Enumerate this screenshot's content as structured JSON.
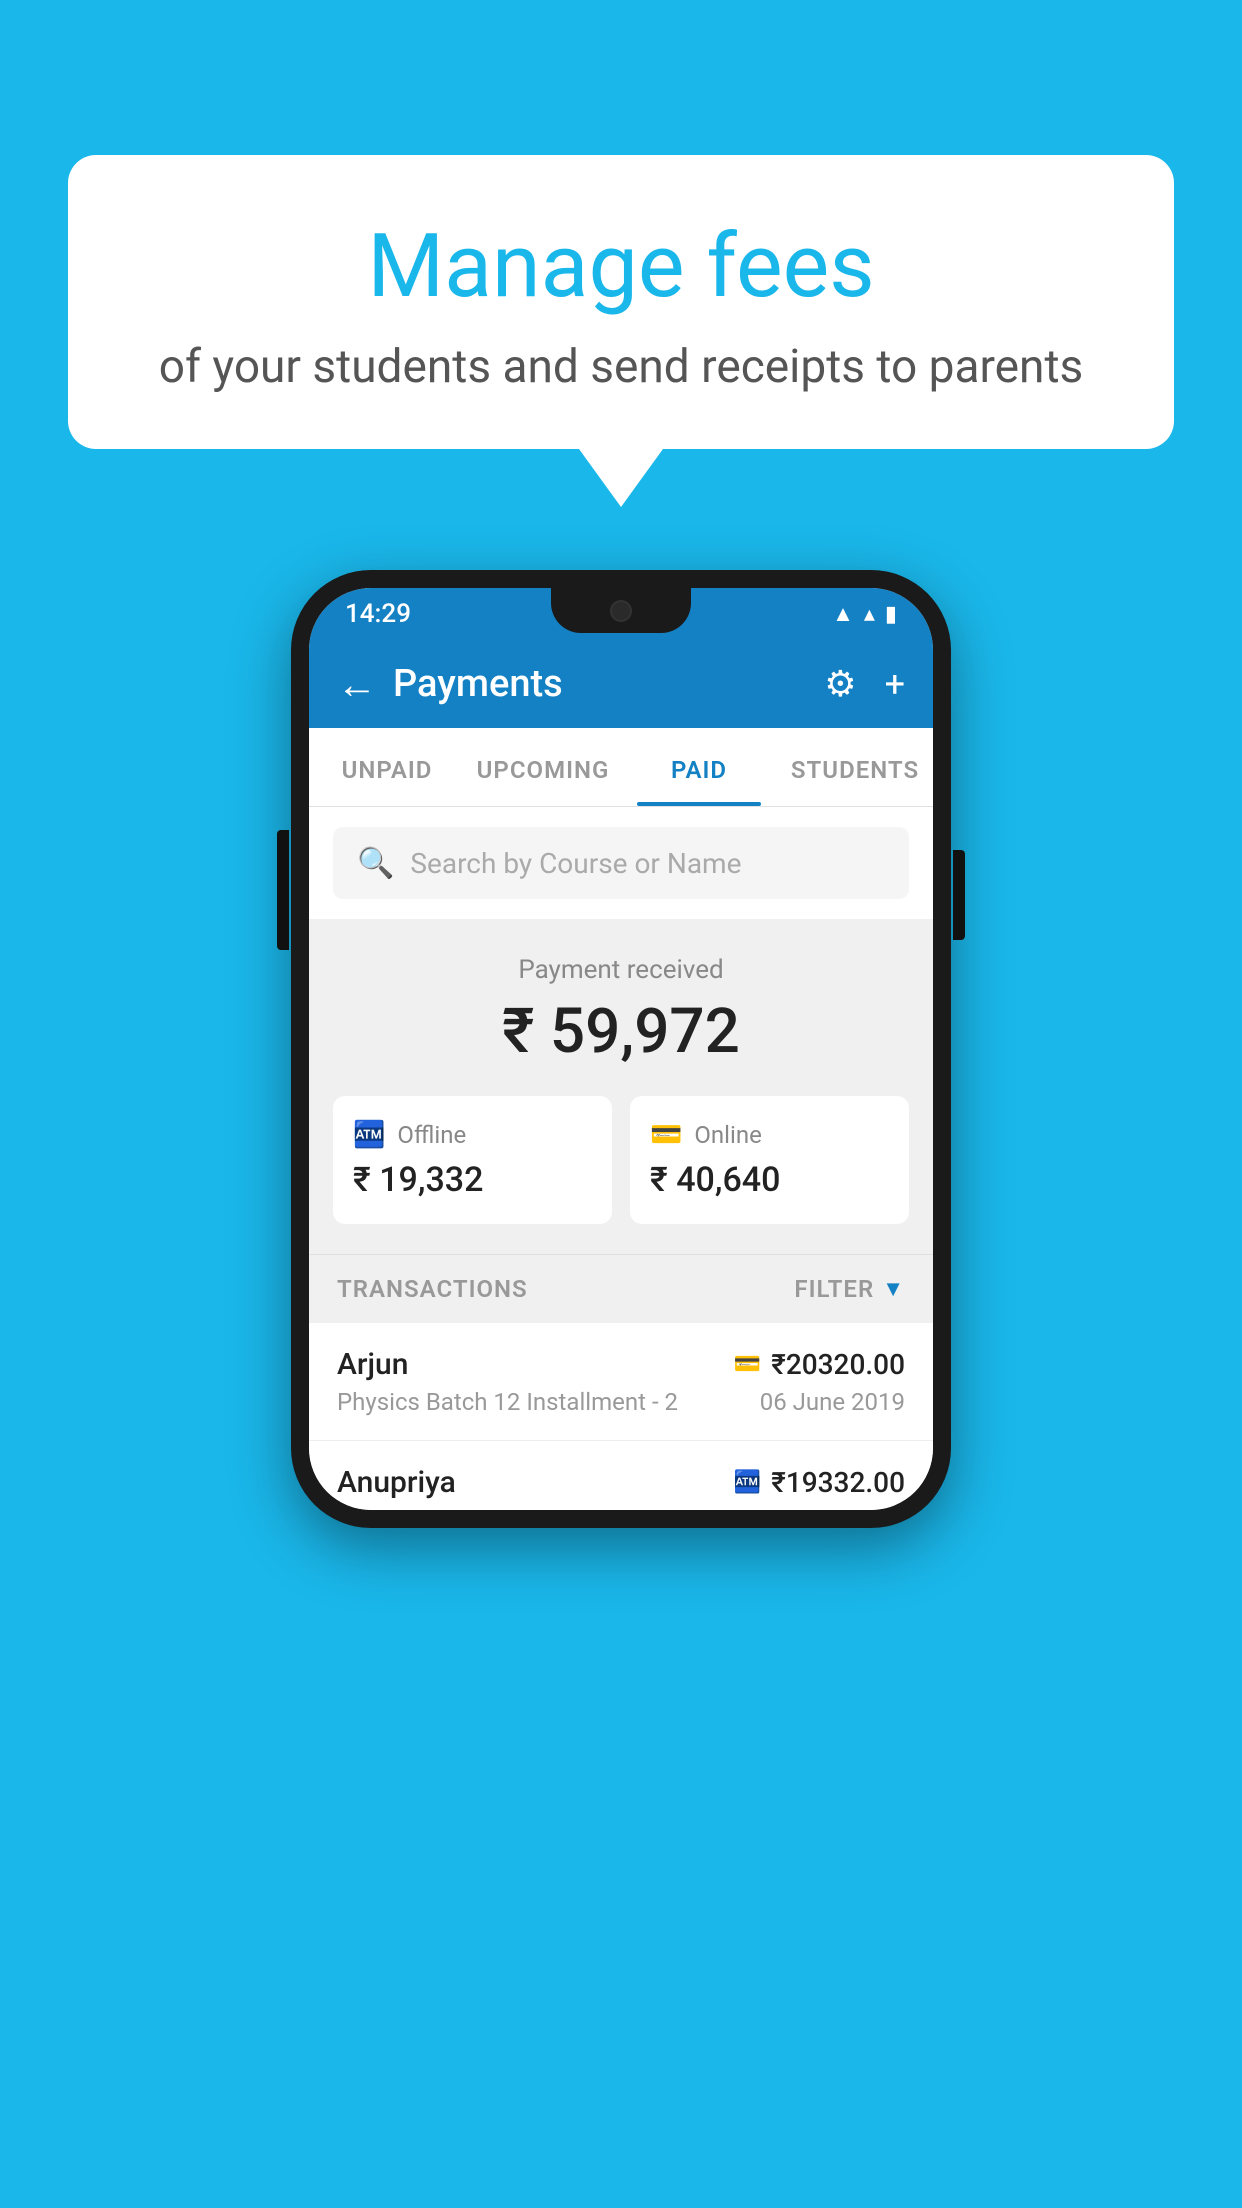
{
  "background": {
    "color": "#1ab7ea"
  },
  "speech_bubble": {
    "title": "Manage fees",
    "subtitle": "of your students and send receipts to parents"
  },
  "status_bar": {
    "time": "14:29",
    "wifi_icon": "▼",
    "signal_icon": "▲",
    "battery_icon": "▮"
  },
  "app_header": {
    "back_label": "←",
    "title": "Payments",
    "gear_icon": "⚙",
    "plus_icon": "+"
  },
  "tabs": [
    {
      "label": "UNPAID",
      "active": false
    },
    {
      "label": "UPCOMING",
      "active": false
    },
    {
      "label": "PAID",
      "active": true
    },
    {
      "label": "STUDENTS",
      "active": false
    }
  ],
  "search": {
    "placeholder": "Search by Course or Name"
  },
  "payment_summary": {
    "received_label": "Payment received",
    "total_amount": "₹ 59,972",
    "offline_label": "Offline",
    "offline_amount": "₹ 19,332",
    "online_label": "Online",
    "online_amount": "₹ 40,640"
  },
  "transactions": {
    "section_label": "TRANSACTIONS",
    "filter_label": "FILTER",
    "rows": [
      {
        "name": "Arjun",
        "amount": "₹20320.00",
        "course": "Physics Batch 12 Installment - 2",
        "date": "06 June 2019",
        "type": "online"
      },
      {
        "name": "Anupriya",
        "amount": "₹19332.00",
        "course": "",
        "date": "",
        "type": "offline"
      }
    ]
  }
}
